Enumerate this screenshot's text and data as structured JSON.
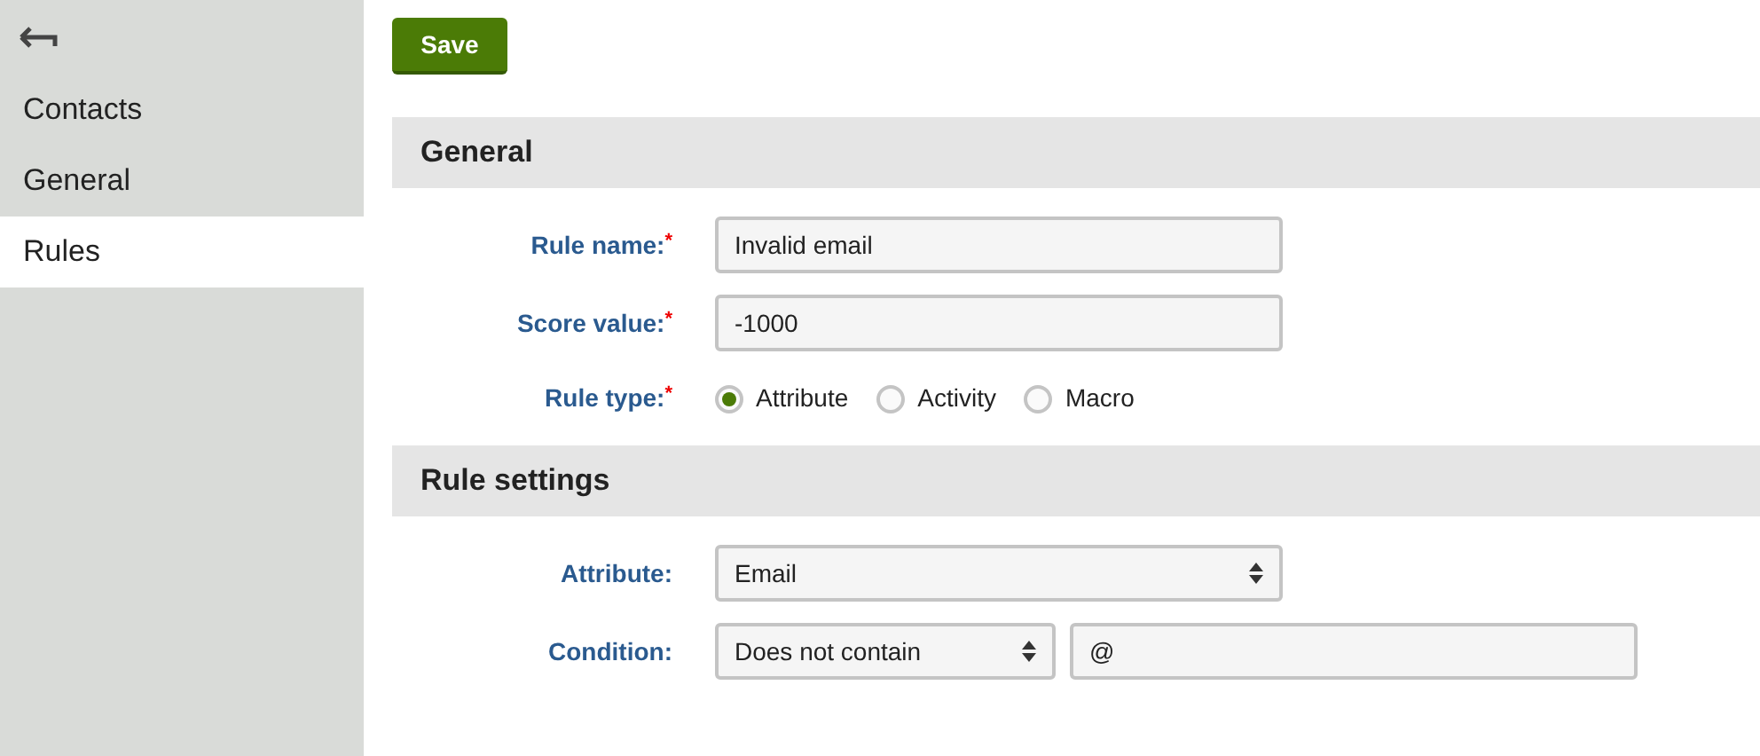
{
  "sidebar": {
    "items": [
      {
        "label": "Contacts",
        "selected": false
      },
      {
        "label": "General",
        "selected": false
      },
      {
        "label": "Rules",
        "selected": true
      }
    ]
  },
  "save_button": "Save",
  "sections": [
    {
      "title": "General",
      "fields": [
        {
          "kind": "text",
          "label": "Rule name:",
          "required_mark": "*",
          "value": "Invalid email"
        },
        {
          "kind": "text",
          "label": "Score value:",
          "required_mark": "*",
          "value": "-1000"
        },
        {
          "kind": "radio",
          "label": "Rule type:",
          "required_mark": "*",
          "options": [
            {
              "label": "Attribute",
              "selected": true
            },
            {
              "label": "Activity",
              "selected": false
            },
            {
              "label": "Macro",
              "selected": false
            }
          ]
        }
      ]
    },
    {
      "title": "Rule settings",
      "fields": [
        {
          "kind": "select",
          "label": "Attribute:",
          "value": "Email"
        },
        {
          "kind": "condition",
          "label": "Condition:",
          "value": "Does not contain",
          "operand": "@"
        }
      ]
    }
  ]
}
